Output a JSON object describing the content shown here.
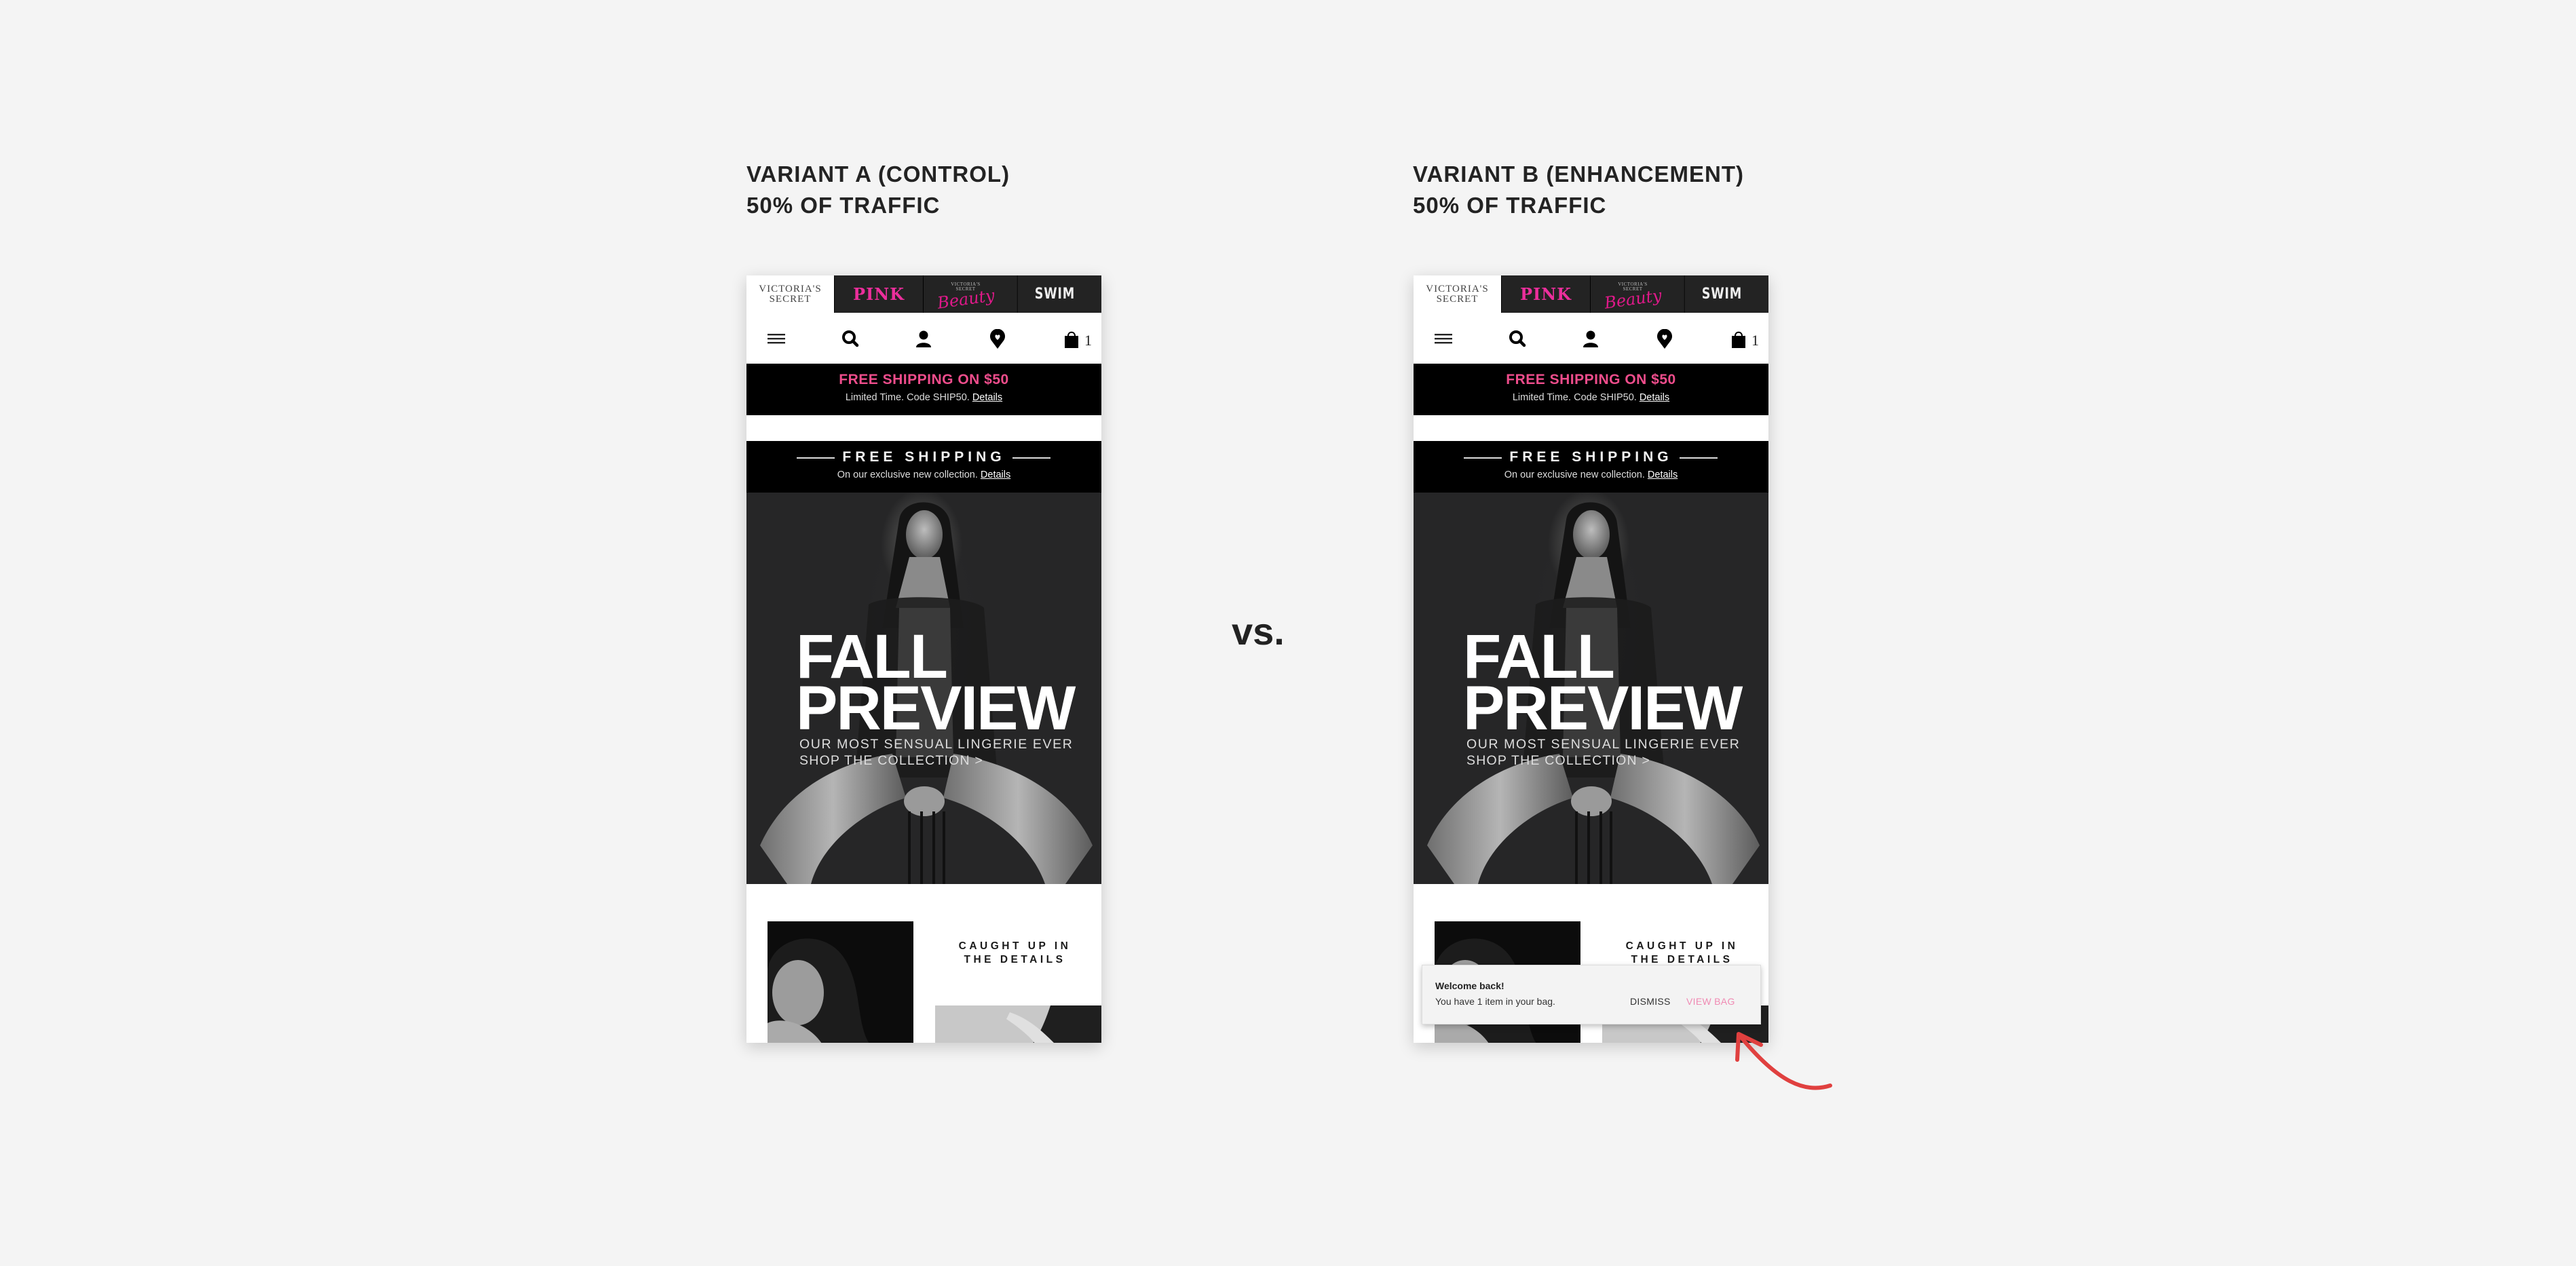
{
  "vs_label": "vs.",
  "variants": [
    {
      "id": "A",
      "header_line1": "VARIANT A (CONTROL)",
      "header_line2": "50% OF TRAFFIC",
      "shows_toast": false
    },
    {
      "id": "B",
      "header_line1": "VARIANT B (ENHANCEMENT)",
      "header_line2": "50% OF TRAFFIC",
      "shows_toast": true
    }
  ],
  "site": {
    "brand_tabs": {
      "vs_line1": "VICTORIA'S",
      "vs_line2": "SECRET",
      "pink": "PINK",
      "beauty_small_line1": "VICTORIA'S",
      "beauty_small_line2": "SECRET",
      "beauty_script": "Beauty",
      "swim": "SWIM"
    },
    "nav": {
      "icons": [
        "hamburger-menu-icon",
        "search-icon",
        "account-icon",
        "store-locator-icon",
        "shopping-bag-icon"
      ],
      "bag_count": "1"
    },
    "promo": {
      "title": "FREE SHIPPING ON $50",
      "subtitle": "Limited Time. Code SHIP50.",
      "link": "Details"
    },
    "free_shipping": {
      "title": "FREE SHIPPING",
      "subtitle": "On our exclusive new collection.",
      "link": "Details"
    },
    "hero": {
      "title_line1": "FALL",
      "title_line2": "PREVIEW",
      "subtitle": "OUR MOST SENSUAL LINGERIE EVER",
      "cta": "SHOP THE COLLECTION >"
    },
    "section": {
      "heading_line1": "CAUGHT UP IN",
      "heading_line2": "THE DETAILS"
    }
  },
  "toast": {
    "title": "Welcome back!",
    "body": "You have 1 item in your bag.",
    "dismiss": "DISMISS",
    "view_bag": "VIEW BAG"
  },
  "colors": {
    "background": "#f4f4f4",
    "pink_accent": "#ef4d8c",
    "brand_pink": "#ec2e9c",
    "view_bag": "#f08ab3",
    "annotation_arrow": "#e0403f"
  }
}
